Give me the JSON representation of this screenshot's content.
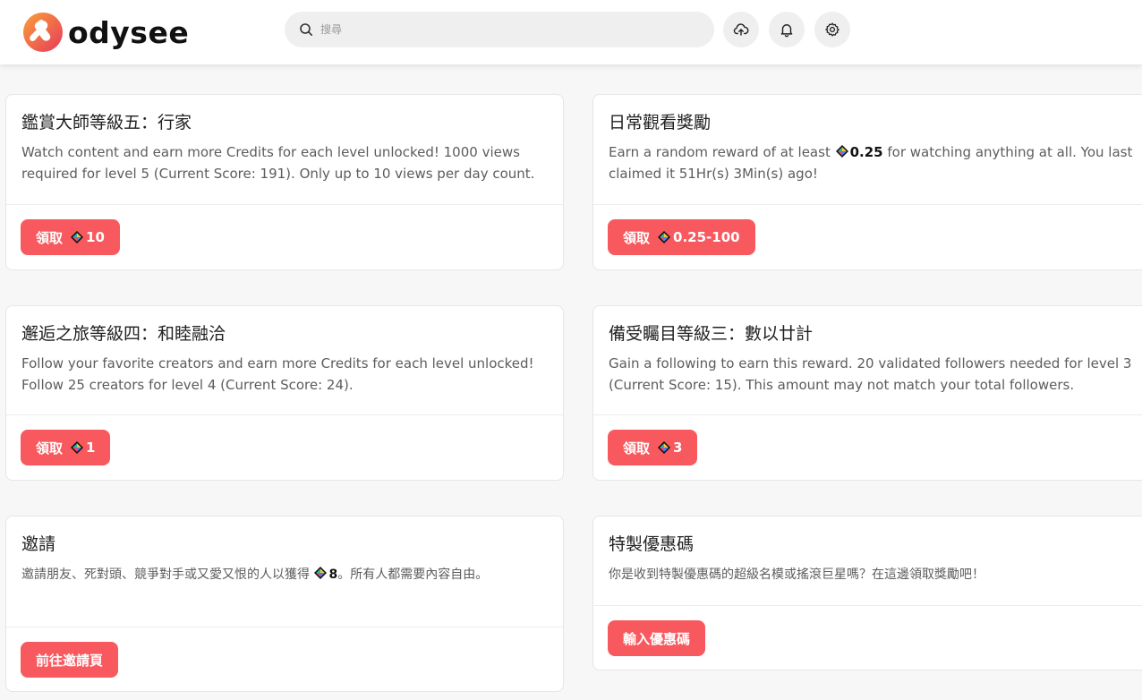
{
  "header": {
    "logo_text": "odysee",
    "search": {
      "placeholder": "搜尋",
      "value": ""
    },
    "icons": [
      "search-icon",
      "upload-icon",
      "bell-icon",
      "gear-icon"
    ]
  },
  "colors": {
    "accent": "#f7595e",
    "background": "#f7f7f7"
  },
  "rewards": [
    {
      "title": "鑑賞大師等級五：行家",
      "desc": "Watch content and earn more Credits for each level unlocked! 1000 views required for level 5 (Current Score: 191). Only up to 10 views per day count.",
      "button_label": "領取",
      "button_amount": "10"
    },
    {
      "title": "日常觀看獎勵",
      "desc_prefix": "Earn a random reward of at least ",
      "desc_amount": "0.25",
      "desc_suffix": " for watching anything at all. You last claimed it 51Hr(s) 3Min(s) ago!",
      "button_label": "領取",
      "button_amount": "0.25-100"
    },
    {
      "title": "邂逅之旅等級四：和睦融洽",
      "desc": "Follow your favorite creators and earn more Credits for each level unlocked! Follow 25 creators for level 4 (Current Score: 24).",
      "button_label": "領取",
      "button_amount": "1"
    },
    {
      "title": "備受矚目等級三：數以廿計",
      "desc": "Gain a following to earn this reward. 20 validated followers needed for level 3 (Current Score: 15). This amount may not match your total followers.",
      "button_label": "領取",
      "button_amount": "3"
    },
    {
      "title": "邀請",
      "desc_prefix": "邀請朋友、死對頭、競爭對手或又愛又恨的人以獲得 ",
      "desc_amount": "8",
      "desc_suffix": "。所有人都需要內容自由。",
      "button_label": "前往邀請頁"
    },
    {
      "title": "特製優惠碼",
      "desc": "你是收到特製優惠碼的超級名模或搖滾巨星嗎？在這邊領取獎勵吧！",
      "button_label": "輸入優惠碼"
    }
  ]
}
